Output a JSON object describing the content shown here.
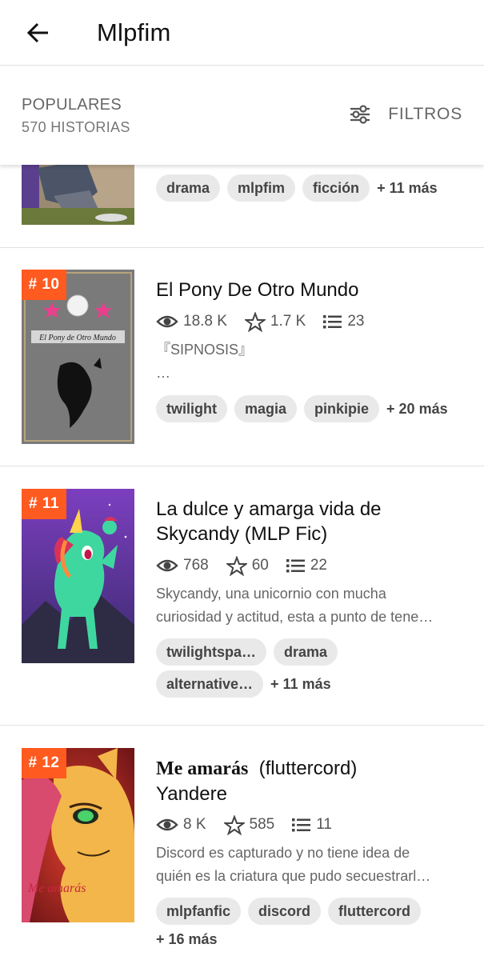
{
  "header": {
    "title": "Mlpfim",
    "back_icon": "arrow-left-icon"
  },
  "toolbar": {
    "sort_label": "POPULARES",
    "count_label": "570 HISTORIAS",
    "filter_label": "FILTROS",
    "filter_icon": "sliders-icon"
  },
  "accent_color": "#ff5a1f",
  "partial_story": {
    "tags": [
      "drama",
      "mlpfim",
      "ficción"
    ],
    "more": "+ 11 más"
  },
  "stories": [
    {
      "rank": "# 10",
      "title": "El Pony De Otro Mundo",
      "views": "18.8 K",
      "votes": "1.7 K",
      "parts": "23",
      "description": [
        "『SIPNOSIS』",
        "…"
      ],
      "tags": [
        "twilight",
        "magia",
        "pinkipie"
      ],
      "more": "+ 20 más",
      "cover_text": "El Pony de Otro Mundo"
    },
    {
      "rank": "# 11",
      "title_lines": [
        "La dulce y amarga vida de",
        "Skycandy (MLP Fic)"
      ],
      "views": "768",
      "votes": "60",
      "parts": "22",
      "description": [
        "Skycandy, una unicornio con mucha",
        "curiosidad y actitud, esta a punto de tene…"
      ],
      "tags_row1": [
        "twilightspa…",
        "drama"
      ],
      "tags_row2": [
        "alternative…"
      ],
      "more": "+ 11 más"
    },
    {
      "rank": "# 12",
      "title_serif": "Me amarás",
      "title_rest": "(fluttercord)",
      "title_line2": "Yandere",
      "views": "8 K",
      "votes": "585",
      "parts": "11",
      "description": [
        "Discord es capturado y no tiene idea de",
        "quién es la criatura que pudo secuestrarl…"
      ],
      "tags": [
        "mlpfanfic",
        "discord",
        "fluttercord"
      ],
      "more": "+ 16 más",
      "cover_text": "Me amarás"
    }
  ]
}
